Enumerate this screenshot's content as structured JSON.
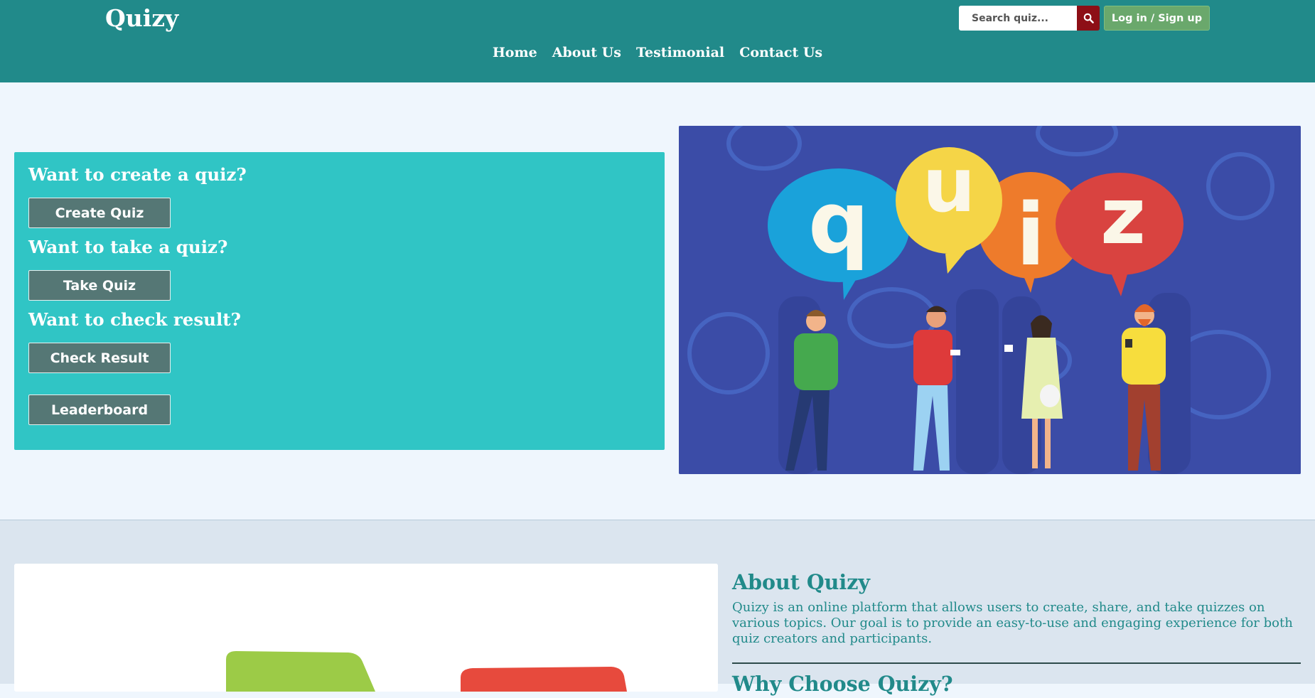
{
  "header": {
    "logo": "Quizy",
    "search": {
      "placeholder": "Search quiz..."
    },
    "login_label": "Log in / Sign up",
    "nav": [
      "Home",
      "About Us",
      "Testimonial",
      "Contact Us"
    ]
  },
  "hero": {
    "create_heading": "Want to create a quiz?",
    "create_button": "Create Quiz",
    "take_heading": "Want to take a quiz?",
    "take_button": "Take Quiz",
    "result_heading": "Want to check result?",
    "result_button": "Check Result",
    "leaderboard_button": "Leaderboard",
    "image_letters": [
      "q",
      "u",
      "i",
      "z"
    ]
  },
  "about": {
    "title": "About Quizy",
    "text": "Quizy is an online platform that allows users to create, share, and take quizzes on various topics. Our goal is to provide an easy-to-use and engaging experience for both quiz creators and participants.",
    "why_title": "Why Choose Quizy?"
  },
  "colors": {
    "header": "#218a8a",
    "panel": "#30c5c5",
    "button": "#557775",
    "search_button": "#8d0f16",
    "login_button": "#6aa86c",
    "hero_image_bg": "#3b4ca7"
  }
}
